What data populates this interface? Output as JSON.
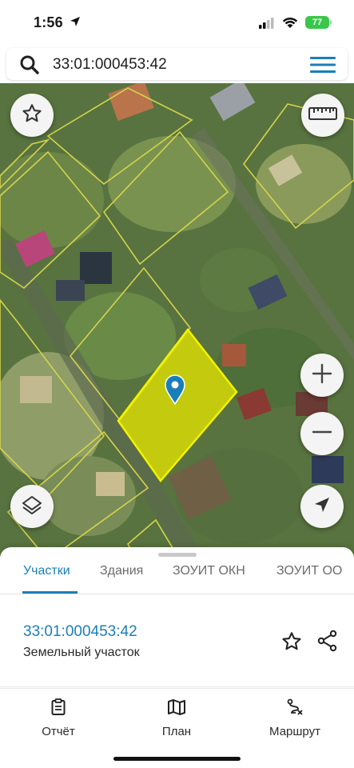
{
  "status_bar": {
    "time": "1:56",
    "battery": "77"
  },
  "search": {
    "query": "33:01:000453:42"
  },
  "map": {
    "selected_color": "#e8e800",
    "outline_color": "#d4d44a"
  },
  "sheet": {
    "tabs": [
      {
        "label": "Участки",
        "active": true
      },
      {
        "label": "Здания",
        "active": false
      },
      {
        "label": "ЗОУИТ ОКН",
        "active": false
      },
      {
        "label": "ЗОУИТ ОО",
        "active": false
      }
    ],
    "parcel": {
      "number": "33:01:000453:42",
      "type": "Земельный участок"
    }
  },
  "nav": {
    "items": [
      {
        "label": "Отчёт",
        "icon": "report-icon"
      },
      {
        "label": "План",
        "icon": "map-icon"
      },
      {
        "label": "Маршрут",
        "icon": "route-icon"
      }
    ]
  },
  "colors": {
    "accent": "#1a7fb8",
    "battery": "#3ac64a"
  }
}
